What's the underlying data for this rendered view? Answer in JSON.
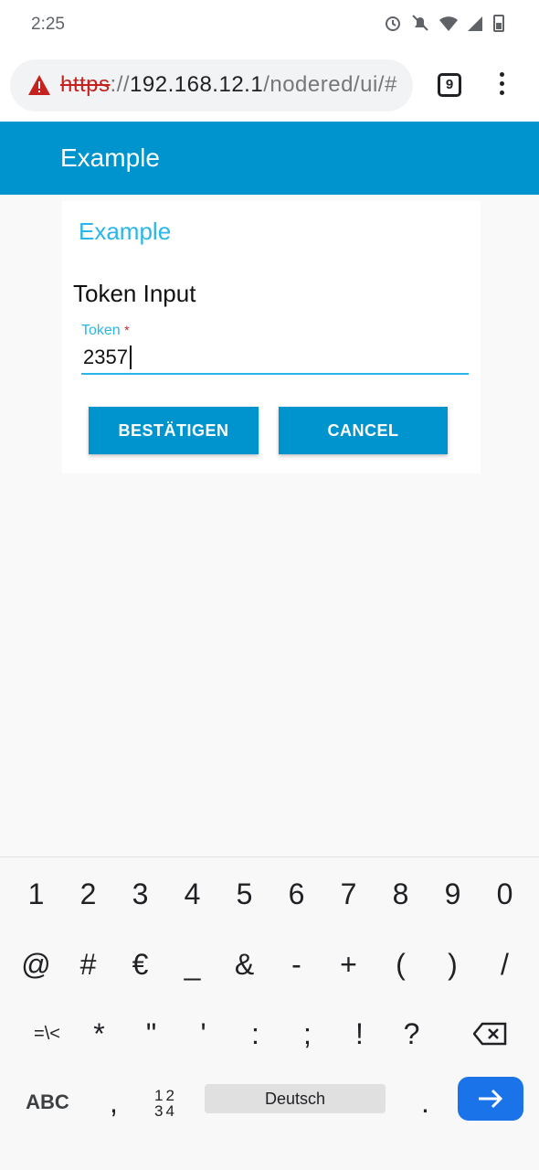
{
  "status_bar": {
    "time": "2:25"
  },
  "browser": {
    "url_scheme": "https",
    "url_sep": "://",
    "url_host": "192.168.12.1",
    "url_path": "/nodered/ui/#",
    "tab_count": "9"
  },
  "app": {
    "title": "Example"
  },
  "card": {
    "title": "Example",
    "section_label": "Token Input",
    "field_label": "Token",
    "required_mark": "*",
    "field_value": "2357",
    "ok_label": "BESTÄTIGEN",
    "cancel_label": "CANCEL"
  },
  "keyboard": {
    "row1": [
      "1",
      "2",
      "3",
      "4",
      "5",
      "6",
      "7",
      "8",
      "9",
      "0"
    ],
    "row2": [
      "@",
      "#",
      "€",
      "_",
      "&",
      "-",
      "+",
      "(",
      ")",
      "/"
    ],
    "row3": [
      "=\\<",
      "*",
      "\"",
      "'",
      ":",
      ";",
      "!",
      "?"
    ],
    "abc_label": "ABC",
    "comma": ",",
    "numpad_top": "12",
    "numpad_bottom": "34",
    "space_label": "Deutsch",
    "period": "."
  },
  "colors": {
    "accent": "#0094ce",
    "title": "#29b6e8",
    "enter": "#1a73e8"
  }
}
